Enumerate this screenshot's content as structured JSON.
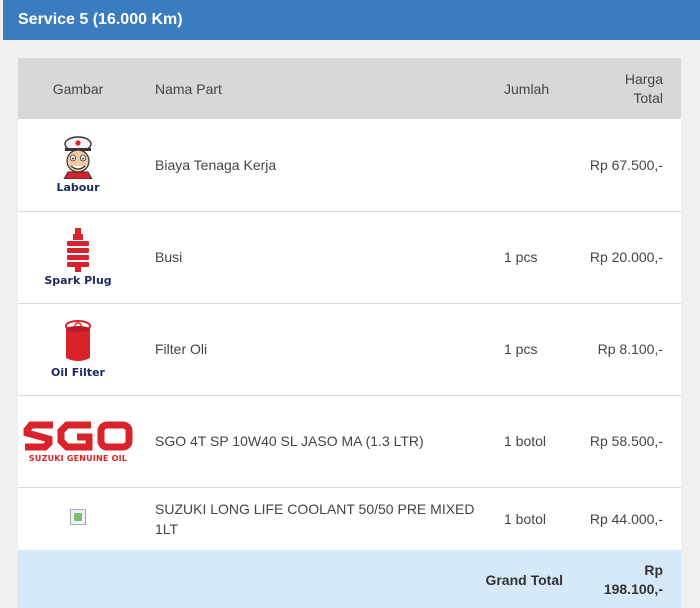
{
  "header": {
    "title": "Service 5 (16.000 Km)"
  },
  "table": {
    "columns": {
      "gambar": "Gambar",
      "nama": "Nama Part",
      "jumlah": "Jumlah",
      "harga_line1": "Harga",
      "harga_line2": "Total"
    },
    "rows": [
      {
        "icon": "labour-mechanic-icon",
        "icon_label": "Labour",
        "nama": "Biaya Tenaga Kerja",
        "jumlah": "",
        "harga": "Rp 67.500,-"
      },
      {
        "icon": "spark-plug-icon",
        "icon_label": "Spark Plug",
        "nama": "Busi",
        "jumlah": "1 pcs",
        "harga": "Rp 20.000,-"
      },
      {
        "icon": "oil-filter-icon",
        "icon_label": "Oil Filter",
        "nama": "Filter Oli",
        "jumlah": "1 pcs",
        "harga": "Rp 8.100,-"
      },
      {
        "icon": "sgo-logo-icon",
        "icon_label": "SUZUKI GENUINE OIL",
        "nama": "SGO 4T SP 10W40 SL JASO MA (1.3 LTR)",
        "jumlah": "1 botol",
        "harga": "Rp 58.500,-"
      },
      {
        "icon": "broken-image-icon",
        "icon_label": "",
        "nama": "SUZUKI LONG LIFE COOLANT 50/50 PRE MIXED 1LT",
        "jumlah": "1 botol",
        "harga": "Rp 44.000,-"
      }
    ],
    "total": {
      "label": "Grand Total",
      "value_line1": "Rp",
      "value_line2": "198.100,-"
    }
  },
  "colors": {
    "header": "#3b7cc0",
    "table_head": "#d8d8d8",
    "total_row": "#d6e9f8",
    "brand_red": "#d8232a"
  }
}
